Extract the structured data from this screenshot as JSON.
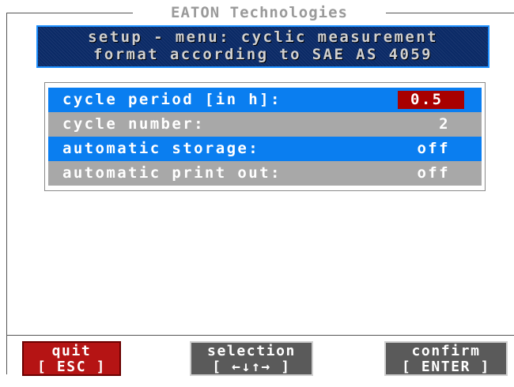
{
  "window": {
    "title": "EATON Technologies"
  },
  "header": {
    "line1": "setup - menu: cyclic measurement",
    "line2": "format according to SAE AS 4059"
  },
  "settings": [
    {
      "label": "cycle period [in h]:",
      "value": "0.5"
    },
    {
      "label": "cycle number:",
      "value": "2"
    },
    {
      "label": "automatic storage:",
      "value": "off"
    },
    {
      "label": "automatic print out:",
      "value": "off"
    }
  ],
  "function_keys": {
    "quit": {
      "label": "quit",
      "key": "[ ESC ]"
    },
    "selection": {
      "label": "selection",
      "key": "[ ←↓↑→ ]"
    },
    "confirm": {
      "label": "confirm",
      "key": "[ ENTER ]"
    }
  },
  "colors": {
    "selected_row": "#0a7ef0",
    "unselected_row": "#a8a8a8",
    "edit_field": "#a80000",
    "header_bg": "#0b2a66",
    "quit_key": "#b51414",
    "nav_key": "#5a5a5a"
  }
}
